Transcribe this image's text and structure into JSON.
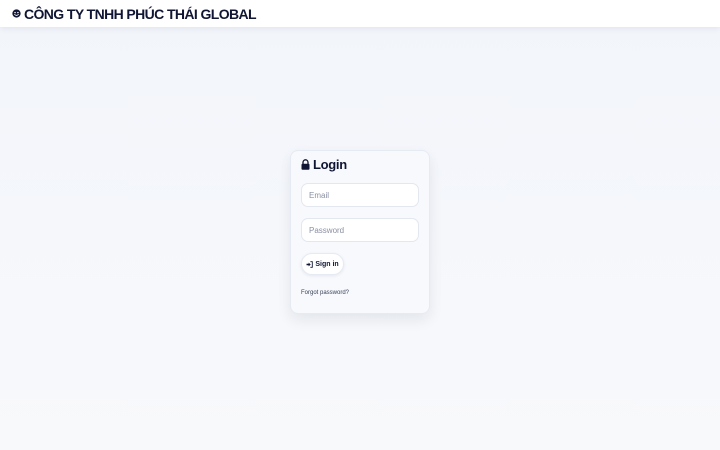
{
  "header": {
    "brand_icon": "smile-icon",
    "company_name": "CÔNG TY TNHH PHÚC THÁI GLOBAL"
  },
  "login": {
    "title_icon": "lock-icon",
    "title": "Login",
    "email": {
      "placeholder": "Email",
      "value": ""
    },
    "password": {
      "placeholder": "Password",
      "value": ""
    },
    "signin_icon": "sign-in-icon",
    "signin_label": "Sign in",
    "forgot_label": "Forgot password?"
  },
  "colors": {
    "text_primary": "#0f1533",
    "background": "#f4f6fa",
    "card_background": "#f7f9fd",
    "input_border": "#e3e7ef",
    "placeholder": "#8a90a2"
  }
}
